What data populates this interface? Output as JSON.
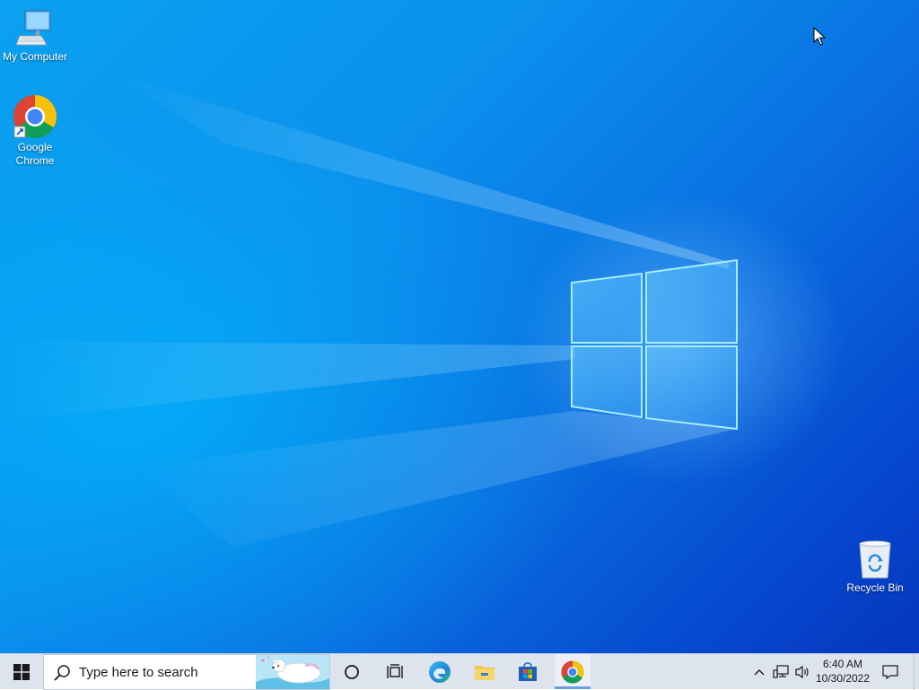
{
  "desktop": {
    "icons": [
      {
        "label": "My Computer",
        "icon": "computer-icon"
      },
      {
        "label": "Google Chrome",
        "icon": "chrome-icon"
      },
      {
        "label": "Recycle Bin",
        "icon": "recycle-bin-icon"
      }
    ],
    "wallpaper": {
      "name": "windows-logo",
      "accent": "#0b90ee"
    }
  },
  "taskbar": {
    "search_placeholder": "Type here to search",
    "pinned": [
      {
        "name": "cortana",
        "icon": "circle-icon"
      },
      {
        "name": "task-view",
        "icon": "task-view-icon"
      },
      {
        "name": "edge",
        "icon": "edge-icon"
      },
      {
        "name": "file-explorer",
        "icon": "folder-icon"
      },
      {
        "name": "store",
        "icon": "store-icon"
      },
      {
        "name": "chrome",
        "icon": "chrome-icon",
        "active": true
      }
    ],
    "tray": {
      "time": "6:40 AM",
      "date": "10/30/2022"
    },
    "colors": {
      "background": "#dde4ee",
      "active_underline": "#6aa0e0"
    }
  }
}
